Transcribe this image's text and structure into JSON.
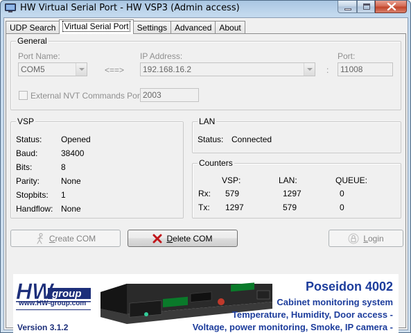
{
  "window": {
    "title": "HW Virtual Serial Port - HW VSP3 (Admin access)"
  },
  "tabs": [
    {
      "label": "UDP Search"
    },
    {
      "label": "Virtual Serial Port"
    },
    {
      "label": "Settings"
    },
    {
      "label": "Advanced"
    },
    {
      "label": "About"
    }
  ],
  "general": {
    "title": "General",
    "port_name_label": "Port Name:",
    "port_name_value": "COM5",
    "arrow": "<==>",
    "ip_label": "IP Address:",
    "ip_value": "192.168.16.2",
    "colon": ":",
    "port_label": "Port:",
    "port_value": "11008",
    "nvt_label": "External NVT Commands Port:",
    "nvt_value": "2003",
    "nvt_checked": false
  },
  "vsp": {
    "title": "VSP",
    "rows": [
      {
        "label": "Status:",
        "value": "Opened"
      },
      {
        "label": "Baud:",
        "value": "38400"
      },
      {
        "label": "Bits:",
        "value": "8"
      },
      {
        "label": "Parity:",
        "value": "None"
      },
      {
        "label": "Stopbits:",
        "value": "1"
      },
      {
        "label": "Handflow:",
        "value": "None"
      }
    ]
  },
  "lan": {
    "title": "LAN",
    "status_label": "Status:",
    "status_value": "Connected"
  },
  "counters": {
    "title": "Counters",
    "headers": [
      "VSP:",
      "LAN:",
      "QUEUE:"
    ],
    "rows": [
      {
        "label": "Rx:",
        "vsp": "579",
        "lan": "1297",
        "queue": "0"
      },
      {
        "label": "Tx:",
        "vsp": "1297",
        "lan": "579",
        "queue": "0"
      }
    ]
  },
  "buttons": {
    "create_first": "C",
    "create_rest": "reate COM",
    "delete_first": "D",
    "delete_rest": "elete COM",
    "login_first": "L",
    "login_rest": "ogin"
  },
  "banner": {
    "logo_text_hw": "HW",
    "logo_text_group": "group",
    "url": "www.HW-group.com",
    "version": "Version  3.1.2",
    "product": "Poseidon 4002",
    "line1": "Cabinet monitoring system",
    "line2": "Temperature, Humidity, Door access -",
    "line3": "Voltage, power monitoring, Smoke, IP camera -"
  },
  "colors": {
    "banner_text": "#1d3d9c",
    "delete_icon": "#c0161b"
  }
}
